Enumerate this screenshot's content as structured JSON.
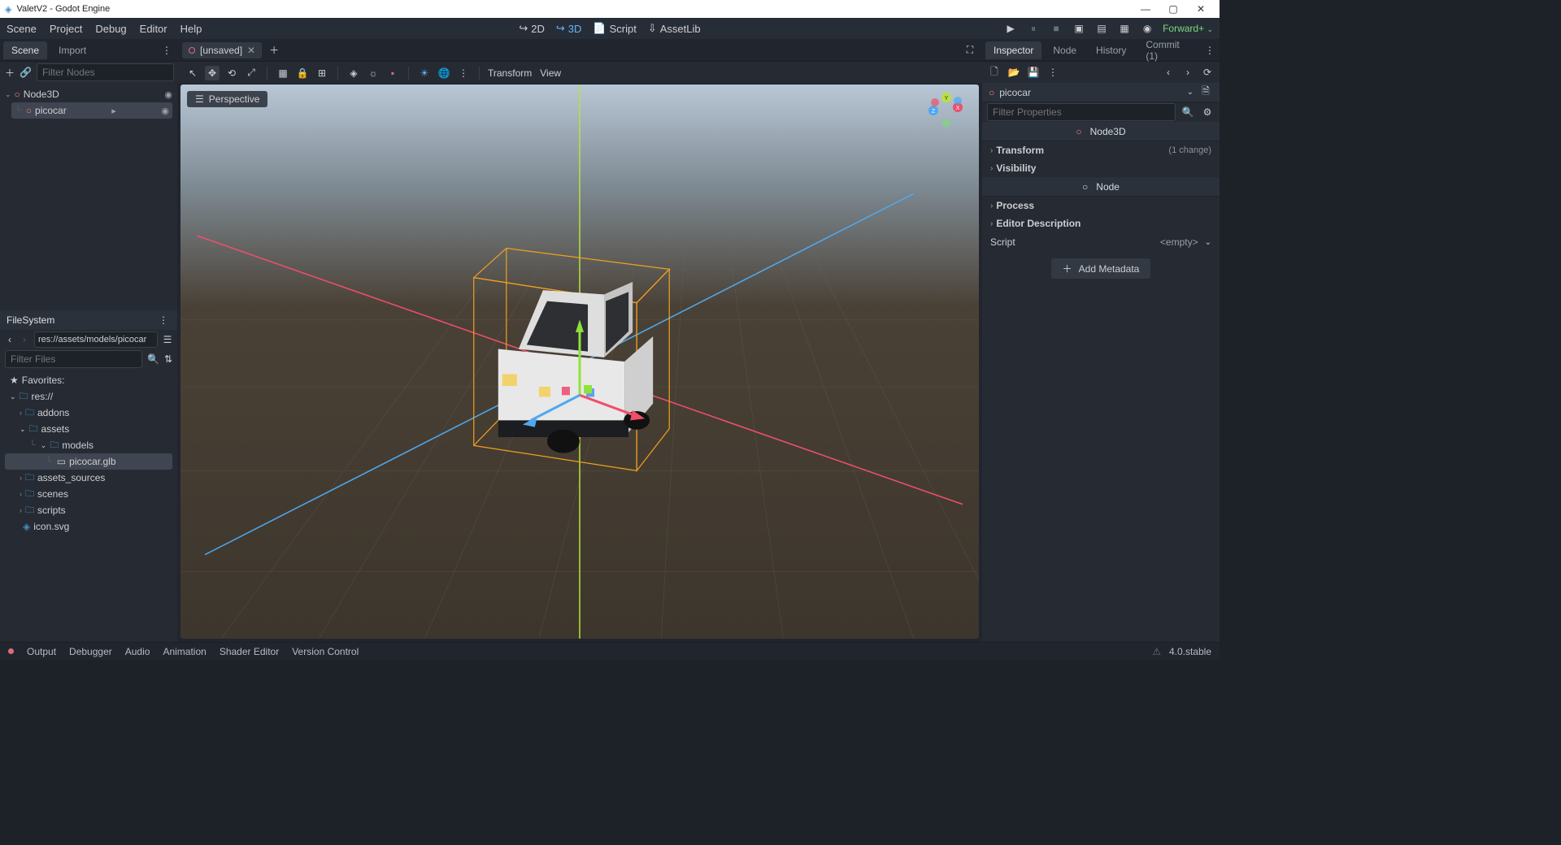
{
  "window": {
    "title": "ValetV2 - Godot Engine"
  },
  "menu": {
    "items": [
      "Scene",
      "Project",
      "Debug",
      "Editor",
      "Help"
    ]
  },
  "workspace": {
    "modes": {
      "twoD": "2D",
      "threeD": "3D",
      "script": "Script",
      "assetlib": "AssetLib"
    },
    "render_mode": "Forward+"
  },
  "left": {
    "scene_tab": "Scene",
    "import_tab": "Import",
    "filter_nodes_ph": "Filter Nodes",
    "tree": {
      "root": "Node3D",
      "child": "picocar"
    },
    "filesystem": {
      "title": "FileSystem",
      "path": "res://assets/models/picocar",
      "filter_ph": "Filter Files",
      "favorites": "Favorites:",
      "root": "res://",
      "folders": [
        "addons",
        "assets",
        "models"
      ],
      "file": "picocar.glb",
      "more": [
        "assets_sources",
        "scenes",
        "scripts",
        "icon.svg"
      ]
    }
  },
  "center": {
    "scene_tab": "[unsaved]",
    "perspective": "Perspective",
    "vp_menu": {
      "transform": "Transform",
      "view": "View"
    }
  },
  "right": {
    "tabs": [
      "Inspector",
      "Node",
      "History",
      "Commit (1)"
    ],
    "node_name": "picocar",
    "filter_ph": "Filter Properties",
    "sections": {
      "node3d": "Node3D",
      "transform": "Transform",
      "transform_note": "(1 change)",
      "visibility": "Visibility",
      "node": "Node",
      "process": "Process",
      "editor_desc": "Editor Description",
      "script": "Script",
      "script_empty": "<empty>",
      "add_meta": "Add Metadata"
    }
  },
  "bottom": {
    "panels": [
      "Output",
      "Debugger",
      "Audio",
      "Animation",
      "Shader Editor",
      "Version Control"
    ],
    "version": "4.0.stable"
  }
}
